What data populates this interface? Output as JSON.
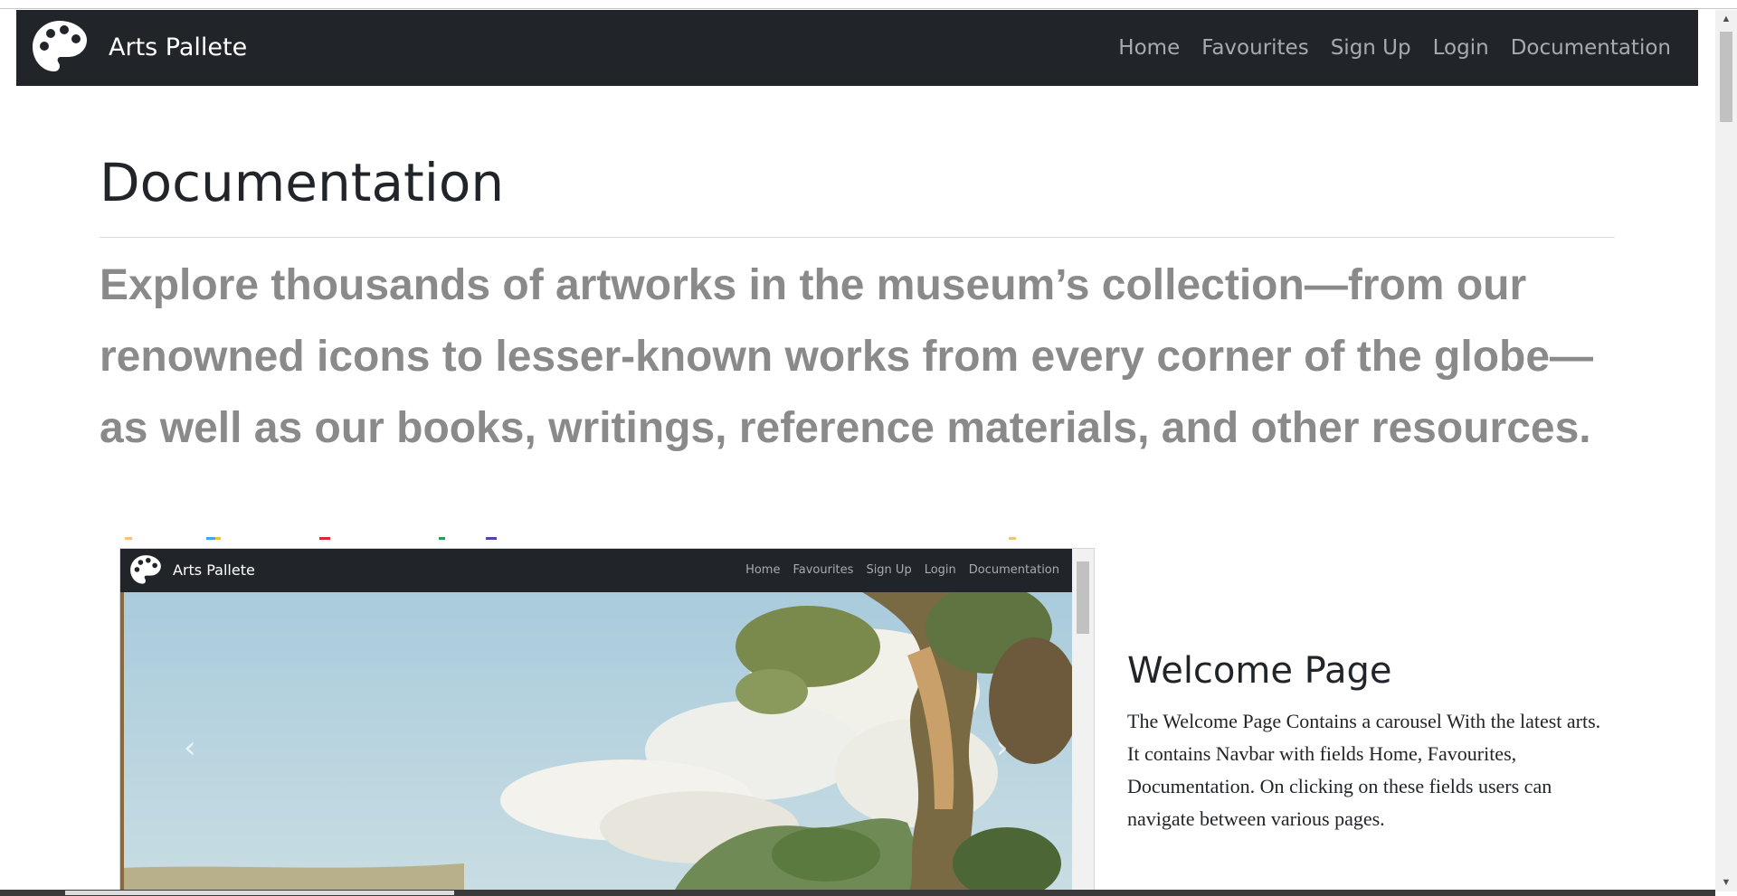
{
  "navbar": {
    "brand": "Arts Pallete",
    "links": [
      "Home",
      "Favourites",
      "Sign Up",
      "Login",
      "Documentation"
    ]
  },
  "page": {
    "title": "Documentation",
    "lead": "Explore thousands of artworks in the museum’s collection—from our renowned icons to lesser-known works from every corner of the globe—as well as our books, writings, reference materials, and other resources."
  },
  "preview": {
    "brand": "Arts Pallete",
    "links": [
      "Home",
      "Favourites",
      "Sign Up",
      "Login",
      "Documentation"
    ],
    "prev_icon": "chevron-left-icon",
    "next_icon": "chevron-right-icon"
  },
  "welcome": {
    "title": "Welcome Page",
    "text": "The Welcome Page Contains a carousel With the latest arts. It contains Navbar with fields Home, Favourites, Documentation. On clicking on these fields users can navigate between various pages."
  },
  "colors": {
    "navbar_bg": "#212529",
    "nav_link": "#a8abae",
    "lead_text": "#8a8a8a"
  }
}
